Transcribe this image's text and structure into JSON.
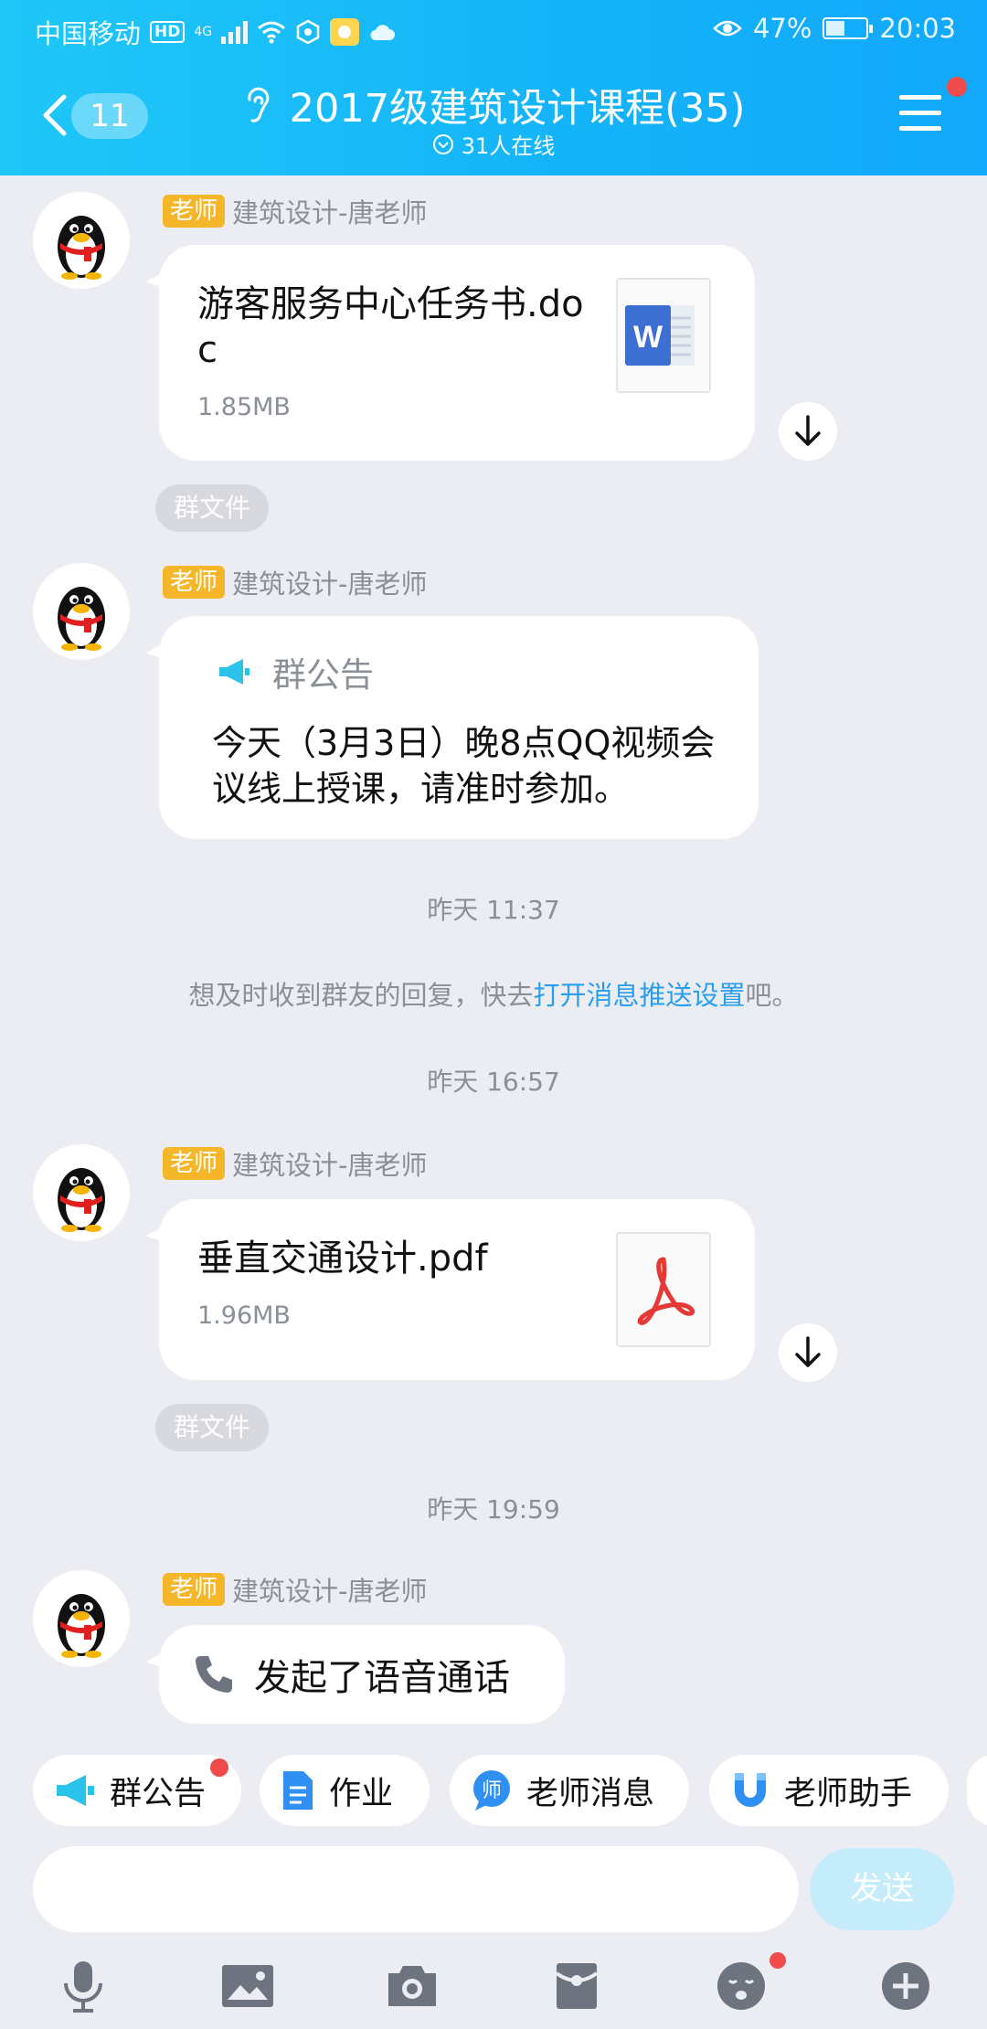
{
  "status_bar": {
    "carrier": "中国移动",
    "hd": "HD",
    "network": "4G",
    "battery_percent": "47%",
    "battery_level": 0.47,
    "time": "20:03"
  },
  "header": {
    "unread_count": "11",
    "title": "2017级建筑设计课程(35)",
    "online_status": "31人在线"
  },
  "messages": [
    {
      "type": "file",
      "role": "老师",
      "sender": "建筑设计-唐老师",
      "file_name": "游客服务中心任务书.doc",
      "file_size": "1.85MB",
      "file_icon": "word-doc-icon",
      "tag": "群文件"
    },
    {
      "type": "notice",
      "role": "老师",
      "sender": "建筑设计-唐老师",
      "notice_title": "群公告",
      "notice_body": "今天（3月3日）晚8点QQ视频会议线上授课，请准时参加。"
    },
    {
      "type": "timestamp",
      "text": "昨天 11:37"
    },
    {
      "type": "tip",
      "text_before": "想及时收到群友的回复，快去",
      "link": "打开消息推送设置",
      "text_after": "吧。"
    },
    {
      "type": "timestamp",
      "text": "昨天 16:57"
    },
    {
      "type": "file",
      "role": "老师",
      "sender": "建筑设计-唐老师",
      "file_name": "垂直交通设计.pdf",
      "file_size": "1.96MB",
      "file_icon": "pdf-icon",
      "tag": "群文件"
    },
    {
      "type": "timestamp",
      "text": "昨天 19:59"
    },
    {
      "type": "call",
      "role": "老师",
      "sender": "建筑设计-唐老师",
      "text": "发起了语音通话"
    }
  ],
  "quick_bar": [
    {
      "label": "群公告",
      "icon": "megaphone-icon",
      "has_dot": true
    },
    {
      "label": "作业",
      "icon": "document-icon",
      "has_dot": false
    },
    {
      "label": "老师消息",
      "icon": "teacher-badge-icon",
      "has_dot": false
    },
    {
      "label": "老师助手",
      "icon": "magnet-icon",
      "has_dot": false
    }
  ],
  "input": {
    "value": "",
    "send_label": "发送"
  },
  "toolbar": [
    {
      "icon": "microphone-icon"
    },
    {
      "icon": "image-icon"
    },
    {
      "icon": "camera-icon"
    },
    {
      "icon": "red-packet-icon"
    },
    {
      "icon": "emoji-icon",
      "has_dot": true
    },
    {
      "icon": "plus-icon"
    }
  ],
  "colors": {
    "header_gradient_start": "#1fc7f7",
    "header_gradient_end": "#12a8fb",
    "role_badge": "#f6b62a",
    "link": "#2a9ef0",
    "send_button_disabled": "#c4ecfb",
    "badge_red": "#f04b4b"
  }
}
